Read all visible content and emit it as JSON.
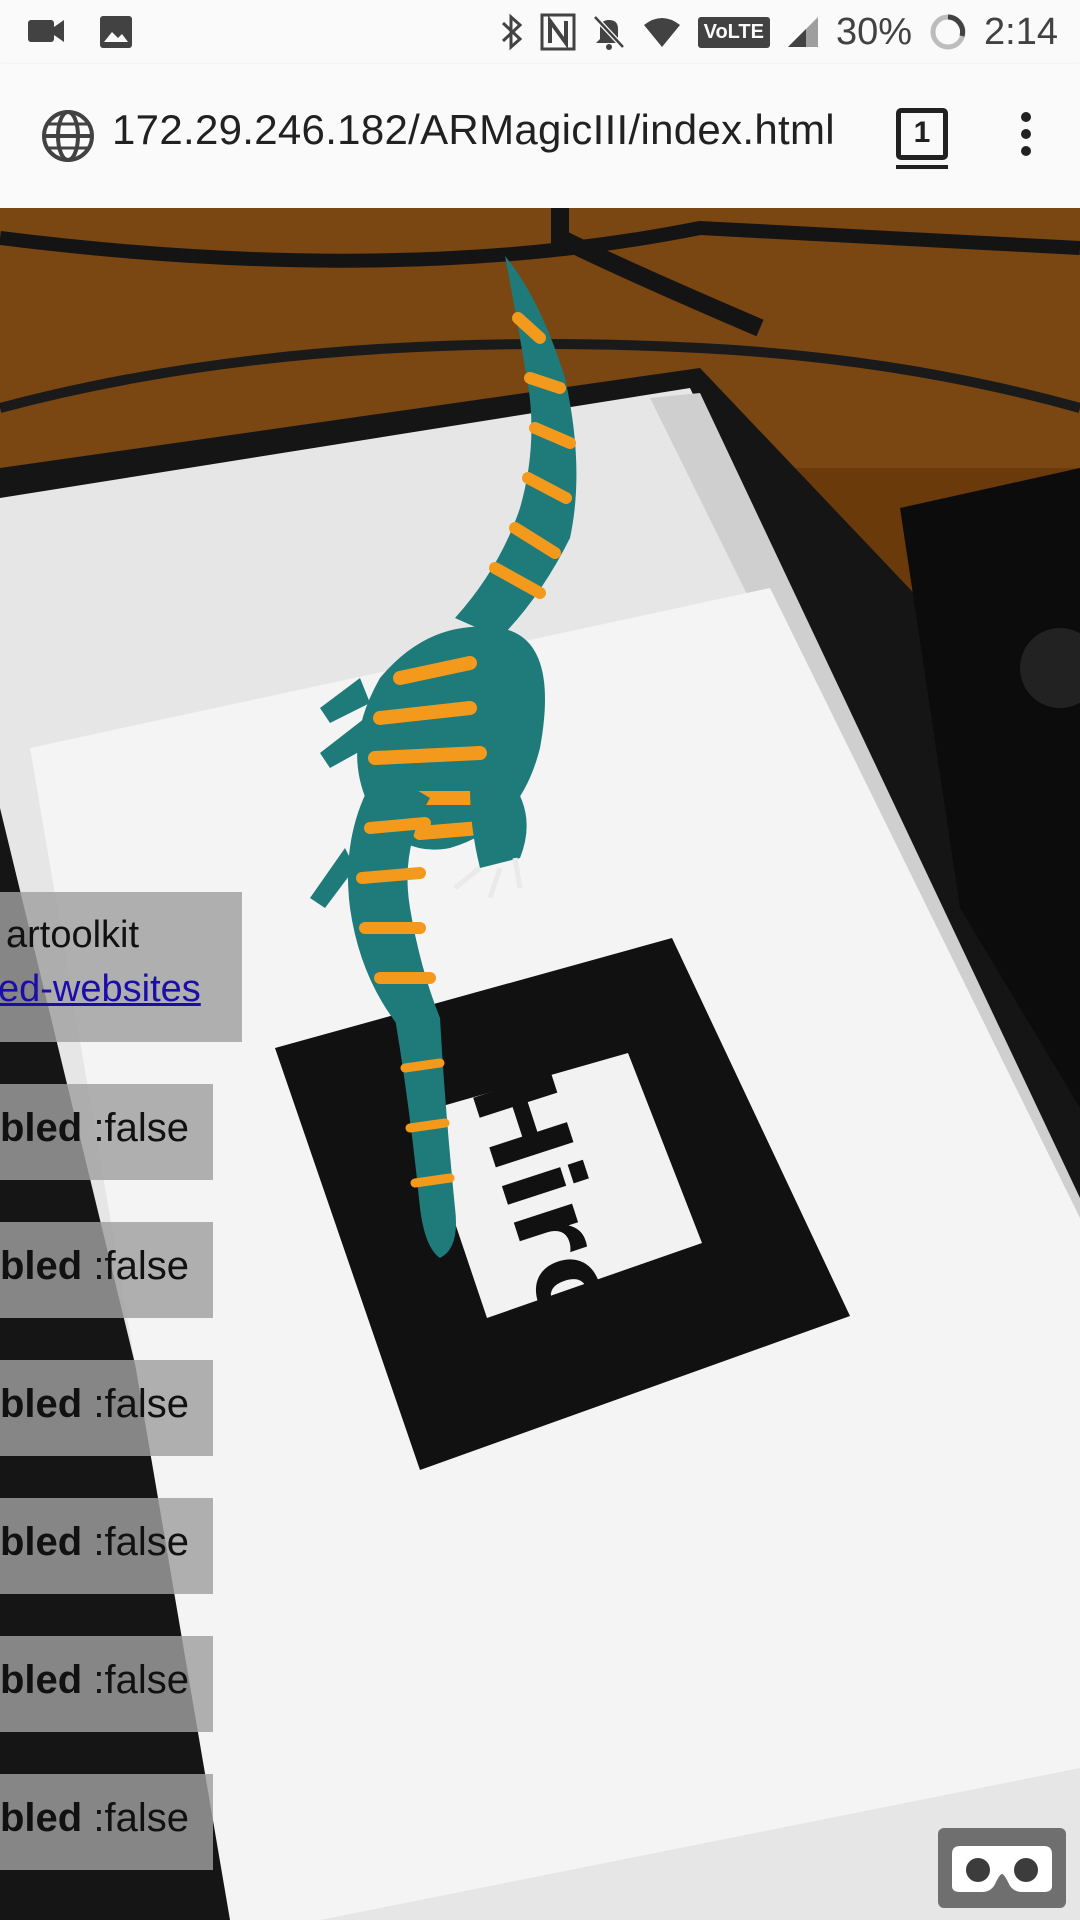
{
  "status_bar": {
    "battery": "30%",
    "time": "2:14",
    "network_badge": "VoLTE",
    "icons": [
      "video-camera-icon",
      "image-icon",
      "bluetooth-icon",
      "nfc-icon",
      "mute-icon",
      "wifi-icon",
      "volte-icon",
      "signal-icon",
      "battery-icon"
    ]
  },
  "browser": {
    "url": "172.29.246.182/ARMagicIII/index.html",
    "tab_count": "1"
  },
  "info_panel": {
    "line1": "artoolkit",
    "link": "ed-websites"
  },
  "flags": [
    {
      "label": "bled",
      "value": ":false"
    },
    {
      "label": "bled",
      "value": ":false"
    },
    {
      "label": "bled",
      "value": ":false"
    },
    {
      "label": "bled",
      "value": ":false"
    },
    {
      "label": "bled",
      "value": ":false"
    },
    {
      "label": "bled",
      "value": ":false"
    }
  ],
  "marker": {
    "text": "Hiro"
  },
  "colors": {
    "dino_body": "#1f7a7a",
    "dino_stripes": "#f39a1c",
    "link": "#1a0dab"
  }
}
